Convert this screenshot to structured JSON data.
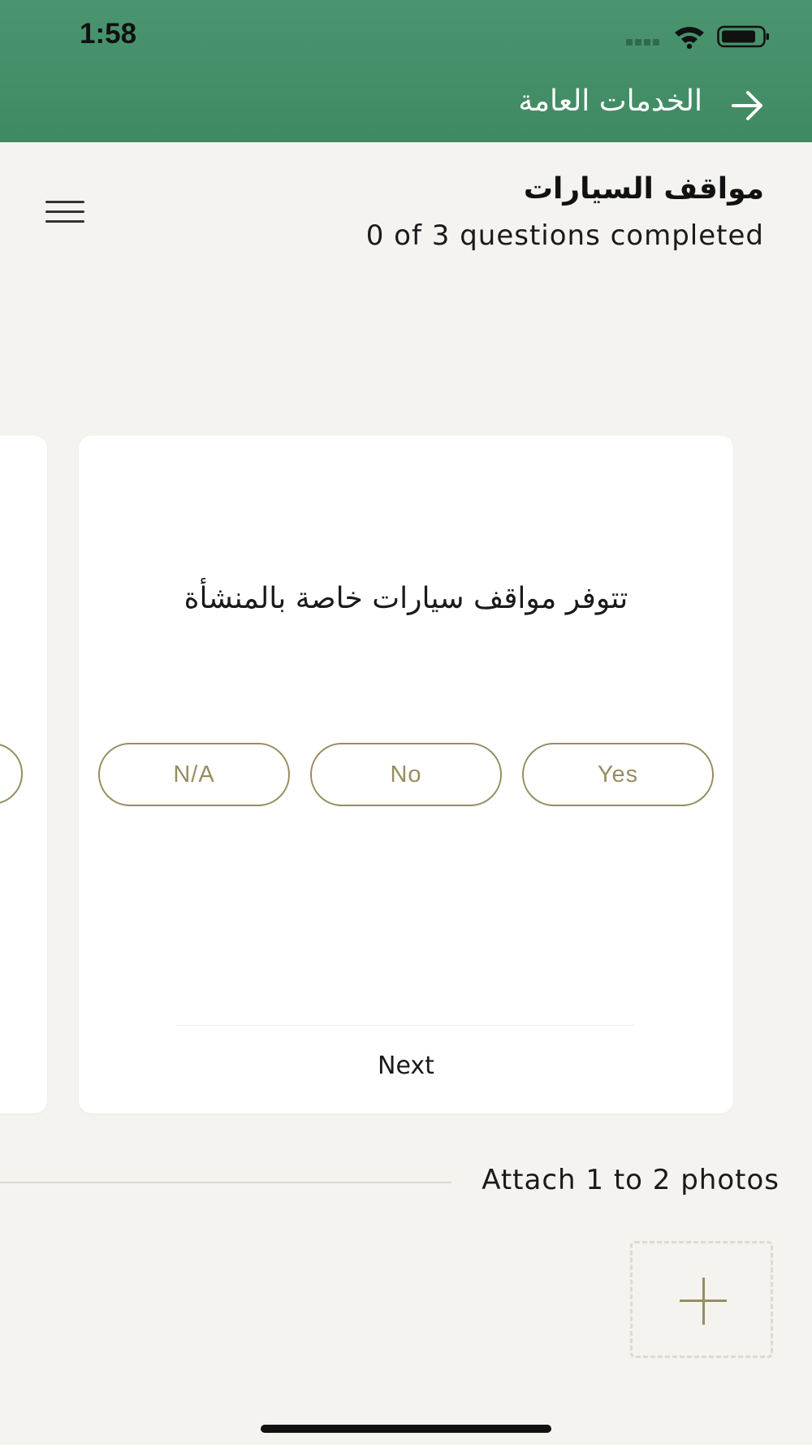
{
  "status_bar": {
    "time": "1:58"
  },
  "header": {
    "title": "الخدمات العامة",
    "back_icon": "arrow-right-icon",
    "color": "#47926b"
  },
  "section": {
    "title": "مواقف السيارات",
    "progress": "0 of 3 questions completed",
    "menu_icon": "hamburger-icon"
  },
  "card": {
    "question": "تتوفر مواقف سيارات خاصة بالمنشأة",
    "answers": {
      "na": "N/A",
      "no": "No",
      "yes": "Yes"
    },
    "next_label": "Next",
    "accent_color": "#978d5f"
  },
  "attachments": {
    "label": "Attach 1 to 2 photos",
    "add_icon": "plus-icon"
  }
}
